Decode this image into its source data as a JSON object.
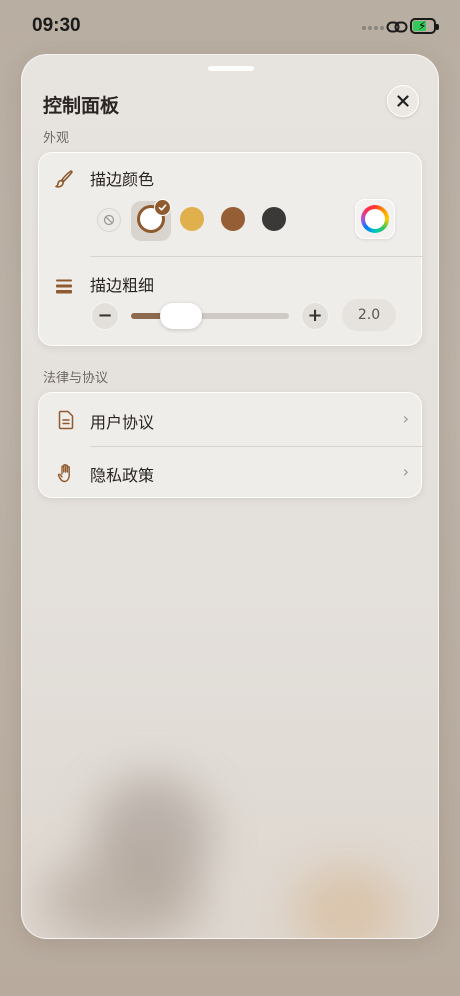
{
  "status_bar": {
    "time": "09:30"
  },
  "panel": {
    "title": "控制面板",
    "appearance": {
      "section_label": "外观",
      "stroke_color": {
        "label": "描边颜色",
        "icon": "brush-icon",
        "swatches": [
          {
            "name": "none",
            "color": "#ecebe9"
          },
          {
            "name": "white",
            "color": "#ffffff",
            "selected": true
          },
          {
            "name": "yellow",
            "color": "#dfb04b"
          },
          {
            "name": "brown",
            "color": "#955e34"
          },
          {
            "name": "dark",
            "color": "#3b3937"
          }
        ],
        "custom_icon": "color-wheel-icon"
      },
      "stroke_width": {
        "label": "描边粗细",
        "icon": "lines-icon",
        "value": "2.0",
        "slider_fraction": 0.2
      }
    },
    "legal": {
      "section_label": "法律与协议",
      "items": [
        {
          "label": "用户协议",
          "icon": "document-icon"
        },
        {
          "label": "隐私政策",
          "icon": "hand-icon"
        }
      ]
    }
  },
  "colors": {
    "accent": "#8f5a2e",
    "card": "#efedea",
    "sheet": "#e6e2de"
  }
}
